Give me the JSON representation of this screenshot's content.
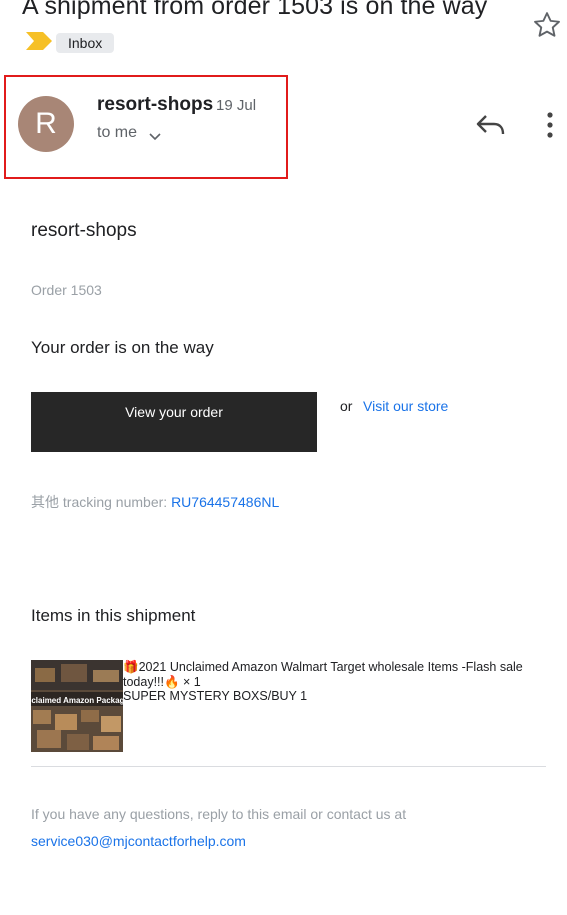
{
  "header": {
    "subject": "A shipment from order 1503 is on the way",
    "label_chip": "Inbox"
  },
  "sender": {
    "avatar_letter": "R",
    "name": "resort-shops",
    "date": "19 Jul",
    "to": "to me"
  },
  "body": {
    "shop_name": "resort-shops",
    "order_number": "Order 1503",
    "headline": "Your order is on the way",
    "view_order_button": "View your order",
    "or_text": "or",
    "visit_store_link": "Visit our store",
    "tracking_label": "其他 tracking number: ",
    "tracking_number": "RU764457486NL",
    "items_title": "Items in this shipment",
    "item": {
      "image_caption": "Unclaimed Amazon Packages",
      "line1": "🎁2021 Unclaimed Amazon Walmart Target wholesale Items -Flash sale today!!!🔥 × 1",
      "line2": "SUPER MYSTERY BOXS/BUY 1"
    },
    "footer_question": "If you have any questions, reply to this email or contact us at",
    "contact_email": "service030@mjcontactforhelp.com"
  }
}
